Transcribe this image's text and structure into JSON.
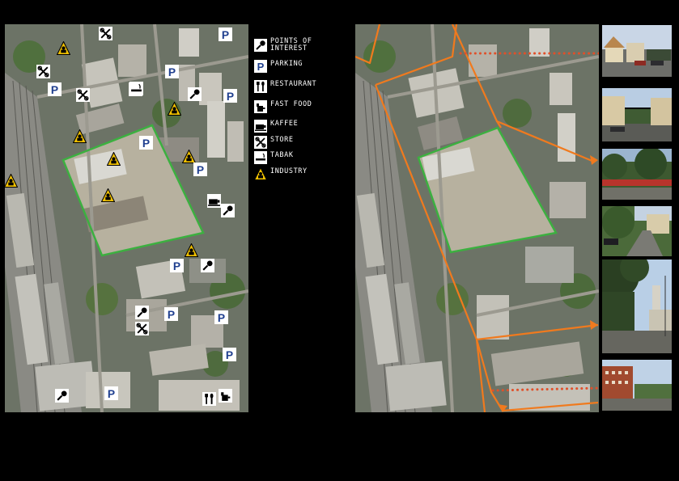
{
  "legend": {
    "items": [
      {
        "key": "poi",
        "label": "POINTS OF INTEREST",
        "icon": "points-of-interest-icon"
      },
      {
        "key": "parking",
        "label": "PARKING",
        "icon": "parking-icon"
      },
      {
        "key": "restaurant",
        "label": "RESTAURANT",
        "icon": "restaurant-icon"
      },
      {
        "key": "fastfood",
        "label": "FAST FOOD",
        "icon": "fast-food-icon"
      },
      {
        "key": "kaffee",
        "label": "KAFFEE",
        "icon": "kaffee-icon"
      },
      {
        "key": "store",
        "label": "STORE",
        "icon": "store-icon"
      },
      {
        "key": "tabak",
        "label": "TABAK",
        "icon": "tabak-icon"
      },
      {
        "key": "industry",
        "label": "INDUSTRY",
        "icon": "industry-icon"
      }
    ]
  },
  "colors": {
    "background": "#000000",
    "site_boundary": "#3cb040",
    "view_lines": "#f07a1e",
    "photo_connector": "#e0502a",
    "parking": "#1f3f8f",
    "industry": "#f2c200",
    "icon_bg": "#ffffff"
  },
  "map_left": {
    "markers": [
      "store",
      "store",
      "industry",
      "parking",
      "parking",
      "store",
      "store",
      "parking",
      "industry",
      "tabak",
      "poi",
      "parking",
      "industry",
      "industry",
      "industry",
      "parking",
      "industry",
      "parking",
      "industry",
      "kaffee",
      "poi",
      "industry",
      "parking",
      "poi",
      "store",
      "poi",
      "parking",
      "parking",
      "parking",
      "poi",
      "parking",
      "restaurant",
      "fastfood"
    ]
  },
  "photos": [
    {
      "name": "street-view-photo-1",
      "scene": "street with houses"
    },
    {
      "name": "street-view-photo-2",
      "scene": "street with apartment blocks"
    },
    {
      "name": "street-view-photo-3",
      "scene": "trees and red fence"
    },
    {
      "name": "street-view-photo-4",
      "scene": "narrow lane with trees"
    },
    {
      "name": "street-view-photo-5",
      "scene": "avenue with tall trees and tower"
    },
    {
      "name": "street-view-photo-6",
      "scene": "street with brick building"
    }
  ]
}
